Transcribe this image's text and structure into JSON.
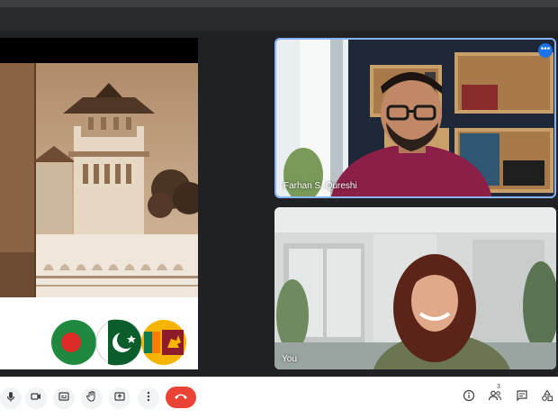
{
  "participants": {
    "remote": {
      "name": "Farhan S. Qureshi"
    },
    "self": {
      "name": "You"
    },
    "count": "3"
  },
  "tile_more_label": "•••",
  "colors": {
    "end_call": "#ea4335",
    "active_speaker_border": "#8ab4f8",
    "accent": "#1a73e8"
  },
  "toolbar": {
    "left_icons": [
      "mic-icon",
      "camera-icon",
      "captions-icon",
      "raise-hand-icon",
      "present-screen-icon",
      "more-options-icon"
    ],
    "end_call_icon": "end-call-icon",
    "right_icons": [
      "info-icon",
      "people-icon",
      "chat-icon",
      "activities-icon"
    ]
  }
}
